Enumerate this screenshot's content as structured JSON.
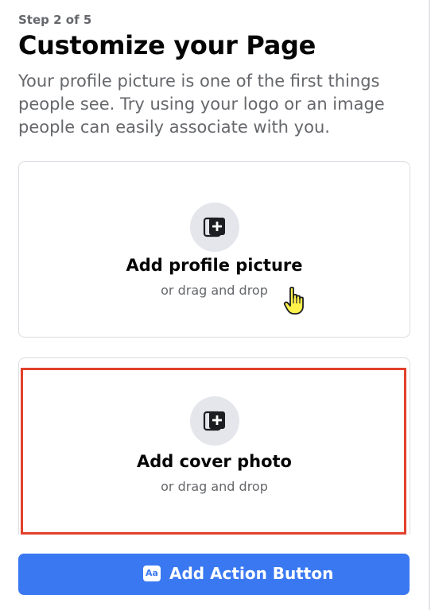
{
  "header": {
    "step": "Step 2 of 5",
    "title": "Customize your Page",
    "description": "Your profile picture is one of the first things people see. Try using your logo or an image people can easily associate with you."
  },
  "profile_card": {
    "icon": "add-photo-icon",
    "label": "Add profile picture",
    "sublabel": "or drag and drop"
  },
  "cover_card": {
    "icon": "add-photo-icon",
    "label": "Add cover photo",
    "sublabel": "or drag and drop"
  },
  "action_button": {
    "icon": "font-aa-icon",
    "icon_text": "Aa",
    "label": "Add Action Button"
  },
  "colors": {
    "primary": "#3a78f2",
    "highlight": "#e2412c",
    "secondary_text": "#65676b",
    "icon_bg": "#e4e6eb"
  }
}
